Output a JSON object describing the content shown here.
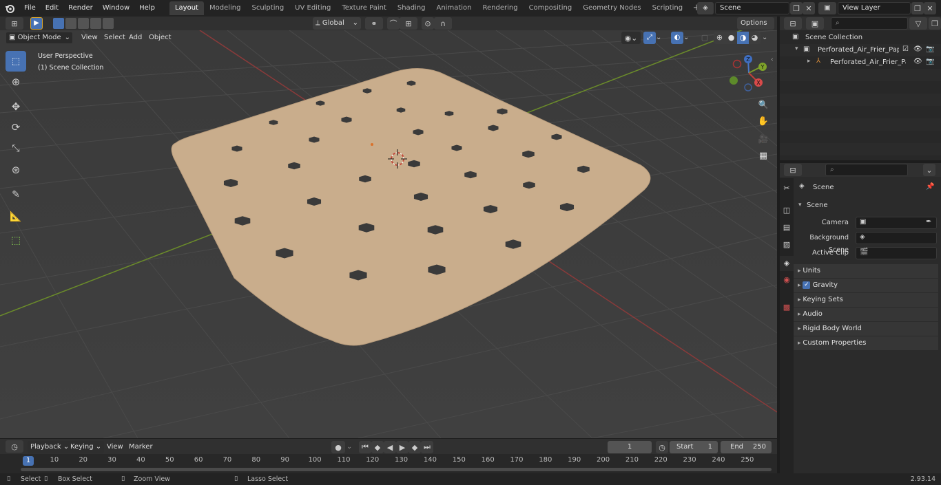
{
  "app": {
    "version": "2.93.14"
  },
  "menu": [
    "File",
    "Edit",
    "Render",
    "Window",
    "Help"
  ],
  "workspaces": [
    {
      "label": "Layout",
      "active": true
    },
    {
      "label": "Modeling"
    },
    {
      "label": "Sculpting"
    },
    {
      "label": "UV Editing"
    },
    {
      "label": "Texture Paint"
    },
    {
      "label": "Shading"
    },
    {
      "label": "Animation"
    },
    {
      "label": "Rendering"
    },
    {
      "label": "Compositing"
    },
    {
      "label": "Geometry Nodes"
    },
    {
      "label": "Scripting"
    }
  ],
  "scene_field": {
    "value": "Scene"
  },
  "view_layer_field": {
    "value": "View Layer"
  },
  "viewport_header": {
    "mode": "Object Mode",
    "menu": [
      "View",
      "Select",
      "Add",
      "Object"
    ],
    "transform_orientation": "Global",
    "options_label": "Options"
  },
  "viewport_overlay": {
    "perspective": "User Perspective",
    "collection": "(1) Scene Collection"
  },
  "gizmo": {
    "x": "X",
    "y": "Y",
    "z": "Z"
  },
  "outliner": {
    "root": "Scene Collection",
    "items": [
      {
        "label": "Perforated_Air_Frier_Paper_Li"
      },
      {
        "label": "Perforated_Air_Frier_Pap"
      }
    ]
  },
  "properties": {
    "breadcrumb": "Scene",
    "section_title": "Scene",
    "fields": [
      {
        "label": "Camera",
        "value": ""
      },
      {
        "label": "Background Scene",
        "value": ""
      },
      {
        "label": "Active Clip",
        "value": ""
      }
    ],
    "panels": [
      {
        "label": "Units"
      },
      {
        "label": "Gravity",
        "checked": true
      },
      {
        "label": "Keying Sets"
      },
      {
        "label": "Audio"
      },
      {
        "label": "Rigid Body World"
      },
      {
        "label": "Custom Properties"
      }
    ]
  },
  "timeline": {
    "menu": [
      "Playback",
      "Keying",
      "View",
      "Marker"
    ],
    "current_frame": "1",
    "start_label": "Start",
    "start": "1",
    "end_label": "End",
    "end": "250",
    "ruler": [
      "1",
      "10",
      "20",
      "30",
      "40",
      "50",
      "60",
      "70",
      "80",
      "90",
      "100",
      "110",
      "120",
      "130",
      "140",
      "150",
      "160",
      "170",
      "180",
      "190",
      "200",
      "210",
      "220",
      "230",
      "240",
      "250"
    ]
  },
  "statusbar": {
    "items": [
      "Select",
      "Box Select",
      "Zoom View",
      "Lasso Select"
    ]
  },
  "colors": {
    "paper": "#c9ad8c",
    "hole": "#3a3a3a",
    "grid": "#464646",
    "x_axis": "#8a3a3a",
    "y_axis": "#6b8c2a",
    "accent": "#4772b3"
  }
}
